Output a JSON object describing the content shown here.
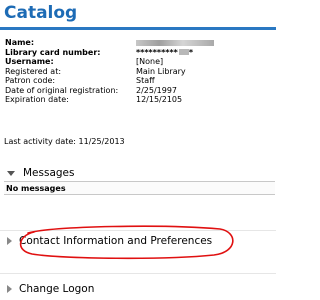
{
  "colors": {
    "title": "#1d6bb5",
    "rule": "#2a78c2",
    "divider": "#e6e6e6",
    "annotation": "#e01010"
  },
  "header": {
    "title": "Catalog"
  },
  "patron_info": {
    "rows": [
      {
        "label": "Name:",
        "value": "",
        "bold": true
      },
      {
        "label": "Library card number:",
        "value": "**********",
        "bold": true
      },
      {
        "label": "Username:",
        "value": "[None]",
        "bold": true
      },
      {
        "label": "Registered at:",
        "value": "Main Library",
        "bold": false
      },
      {
        "label": "Patron code:",
        "value": "Staff",
        "bold": false
      },
      {
        "label": "Date of original registration:",
        "value": "2/25/1997",
        "bold": false
      },
      {
        "label": "Expiration date:",
        "value": "12/15/2105",
        "bold": false
      }
    ]
  },
  "last_activity": "Last activity date: 11/25/2013",
  "sections": {
    "messages": {
      "label": "Messages",
      "empty_text": "No messages"
    },
    "contact": {
      "label": "Contact Information and Preferences"
    },
    "logon": {
      "label": "Change Logon"
    }
  },
  "icons": {
    "messages_toggle": "triangle-down-icon",
    "contact_toggle": "triangle-right-icon",
    "logon_toggle": "triangle-right-icon"
  }
}
